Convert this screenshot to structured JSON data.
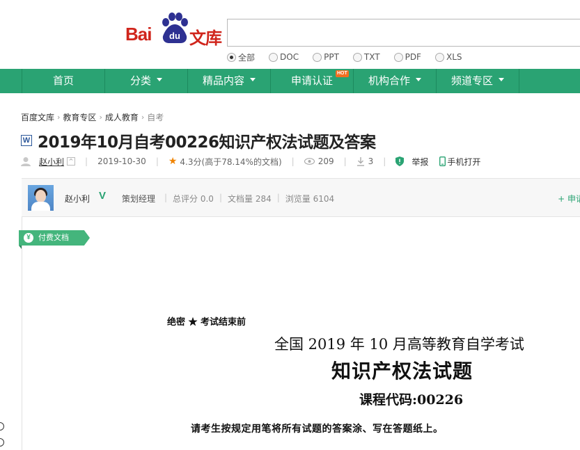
{
  "header": {
    "logo": {
      "bai": "Bai",
      "du": "du",
      "wenku": "文库"
    },
    "search": {
      "value": "",
      "placeholder": ""
    },
    "filters": [
      {
        "label": "全部",
        "checked": true
      },
      {
        "label": "DOC",
        "checked": false
      },
      {
        "label": "PPT",
        "checked": false
      },
      {
        "label": "TXT",
        "checked": false
      },
      {
        "label": "PDF",
        "checked": false
      },
      {
        "label": "XLS",
        "checked": false
      }
    ]
  },
  "nav": {
    "items": [
      {
        "label": "首页"
      },
      {
        "label": "分类"
      },
      {
        "label": "精品内容"
      },
      {
        "label": "申请认证"
      },
      {
        "label": "机构合作"
      },
      {
        "label": "频道专区"
      }
    ],
    "hot_badge": "HOT"
  },
  "breadcrumb": [
    "百度文库",
    "教育专区",
    "成人教育",
    "自考"
  ],
  "doc": {
    "type_icon": "W",
    "title": "2019年10月自考00226知识产权法试题及答案",
    "author": "赵小利",
    "date": "2019-10-30",
    "rating": "4.3分(高于78.14%的文档)",
    "views": "209",
    "downloads": "3",
    "report": "举报",
    "mobile": "手机打开"
  },
  "author_bar": {
    "name": "赵小利",
    "verified": "V",
    "role": "策划经理",
    "score": "总评分 0.0",
    "doc_count": "文档量 284",
    "view_count": "浏览量 6104",
    "follow": "+ 申请"
  },
  "paid_tag": {
    "symbol": "¥",
    "label": "付费文档"
  },
  "preview": {
    "line1": "绝密 ★ 考试结束前",
    "line2": "全国 2019 年 10 月高等教育自学考试",
    "line3": "知识产权法试题",
    "line4": "课程代码:00226",
    "line5": "请考生按规定用笔将所有试题的答案涂、写在答题纸上。"
  },
  "colors": {
    "nav_green": "#2aa373",
    "logo_red": "#d0251c",
    "paw_blue": "#2e3192"
  },
  "icons": [
    "user-icon",
    "star-icon",
    "eye-icon",
    "download-icon",
    "shield-icon",
    "phone-icon",
    "word-icon",
    "yen-icon"
  ]
}
